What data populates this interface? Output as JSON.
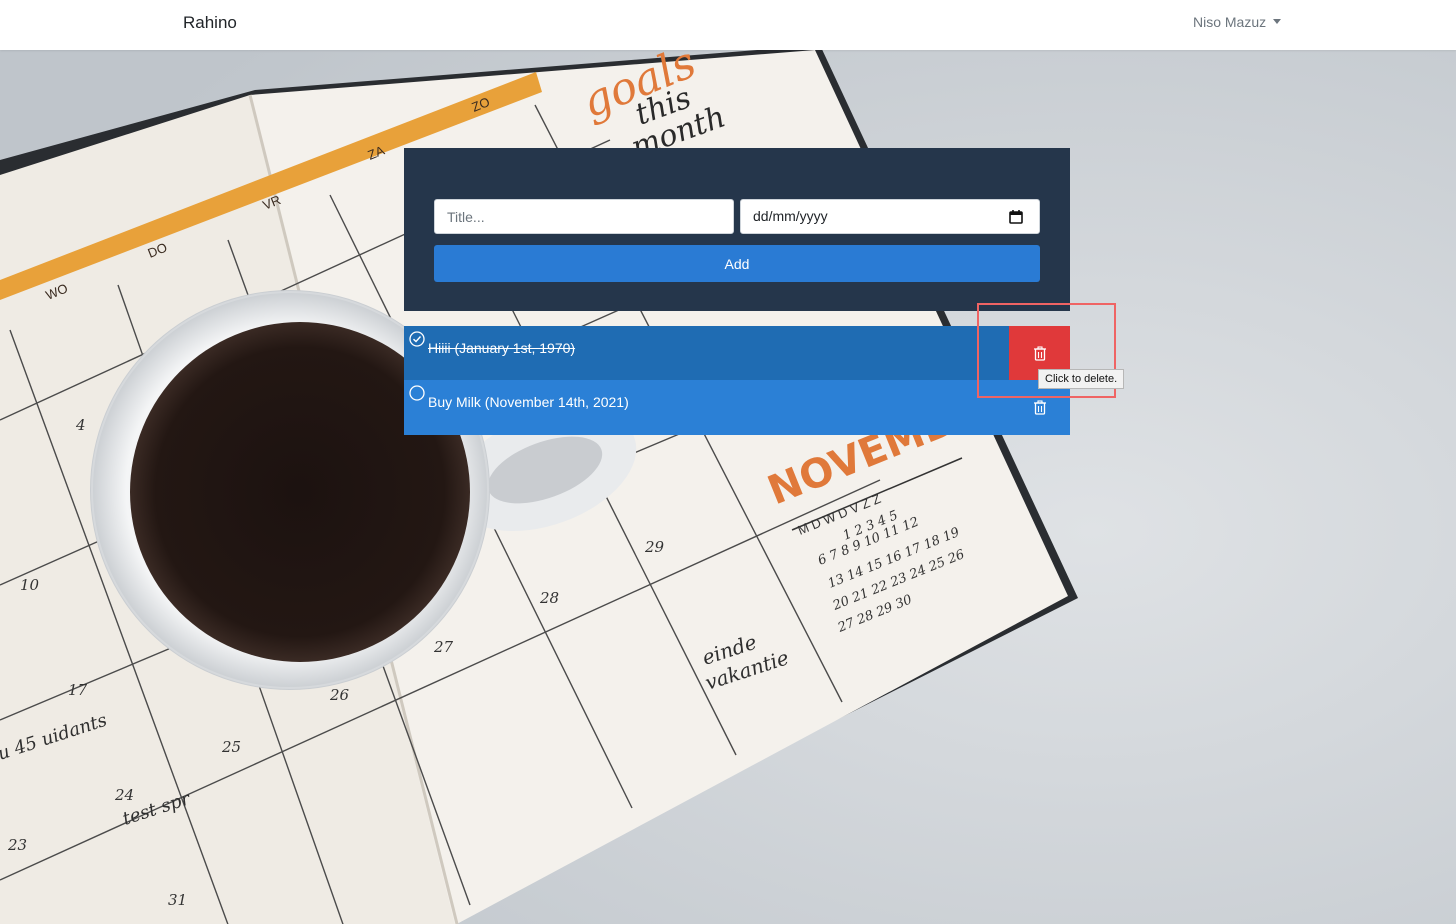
{
  "navbar": {
    "brand": "Rahino",
    "user_name": "Niso Mazuz"
  },
  "form": {
    "title_placeholder": "Title...",
    "date_placeholder": "dd/mm/yyyy",
    "add_label": "Add"
  },
  "todos": [
    {
      "label": "Hiiii (January 1st, 1970)",
      "completed": true
    },
    {
      "label": "Buy Milk (November 14th, 2021)",
      "completed": false
    }
  ],
  "tooltip": "Click to delete.",
  "background": {
    "month_title": "NOVEMBER",
    "goals_text": "goals this month",
    "weekdays": [
      "WO",
      "DO",
      "VR",
      "ZA",
      "ZO"
    ],
    "mini_calendar_header": "M D W D V Z Z",
    "notes": [
      "einde vakantie",
      "test spr"
    ]
  },
  "colors": {
    "panel": "#25364b",
    "add_button": "#2a7bd4",
    "completed_row": "#1f6cb3",
    "open_row": "#2b80d6",
    "delete_active": "#e0393a",
    "highlight": "#ef6464"
  },
  "icons": {
    "check": "check-circle-icon",
    "empty": "circle-icon",
    "delete": "trash-icon",
    "calendar": "calendar-icon"
  }
}
